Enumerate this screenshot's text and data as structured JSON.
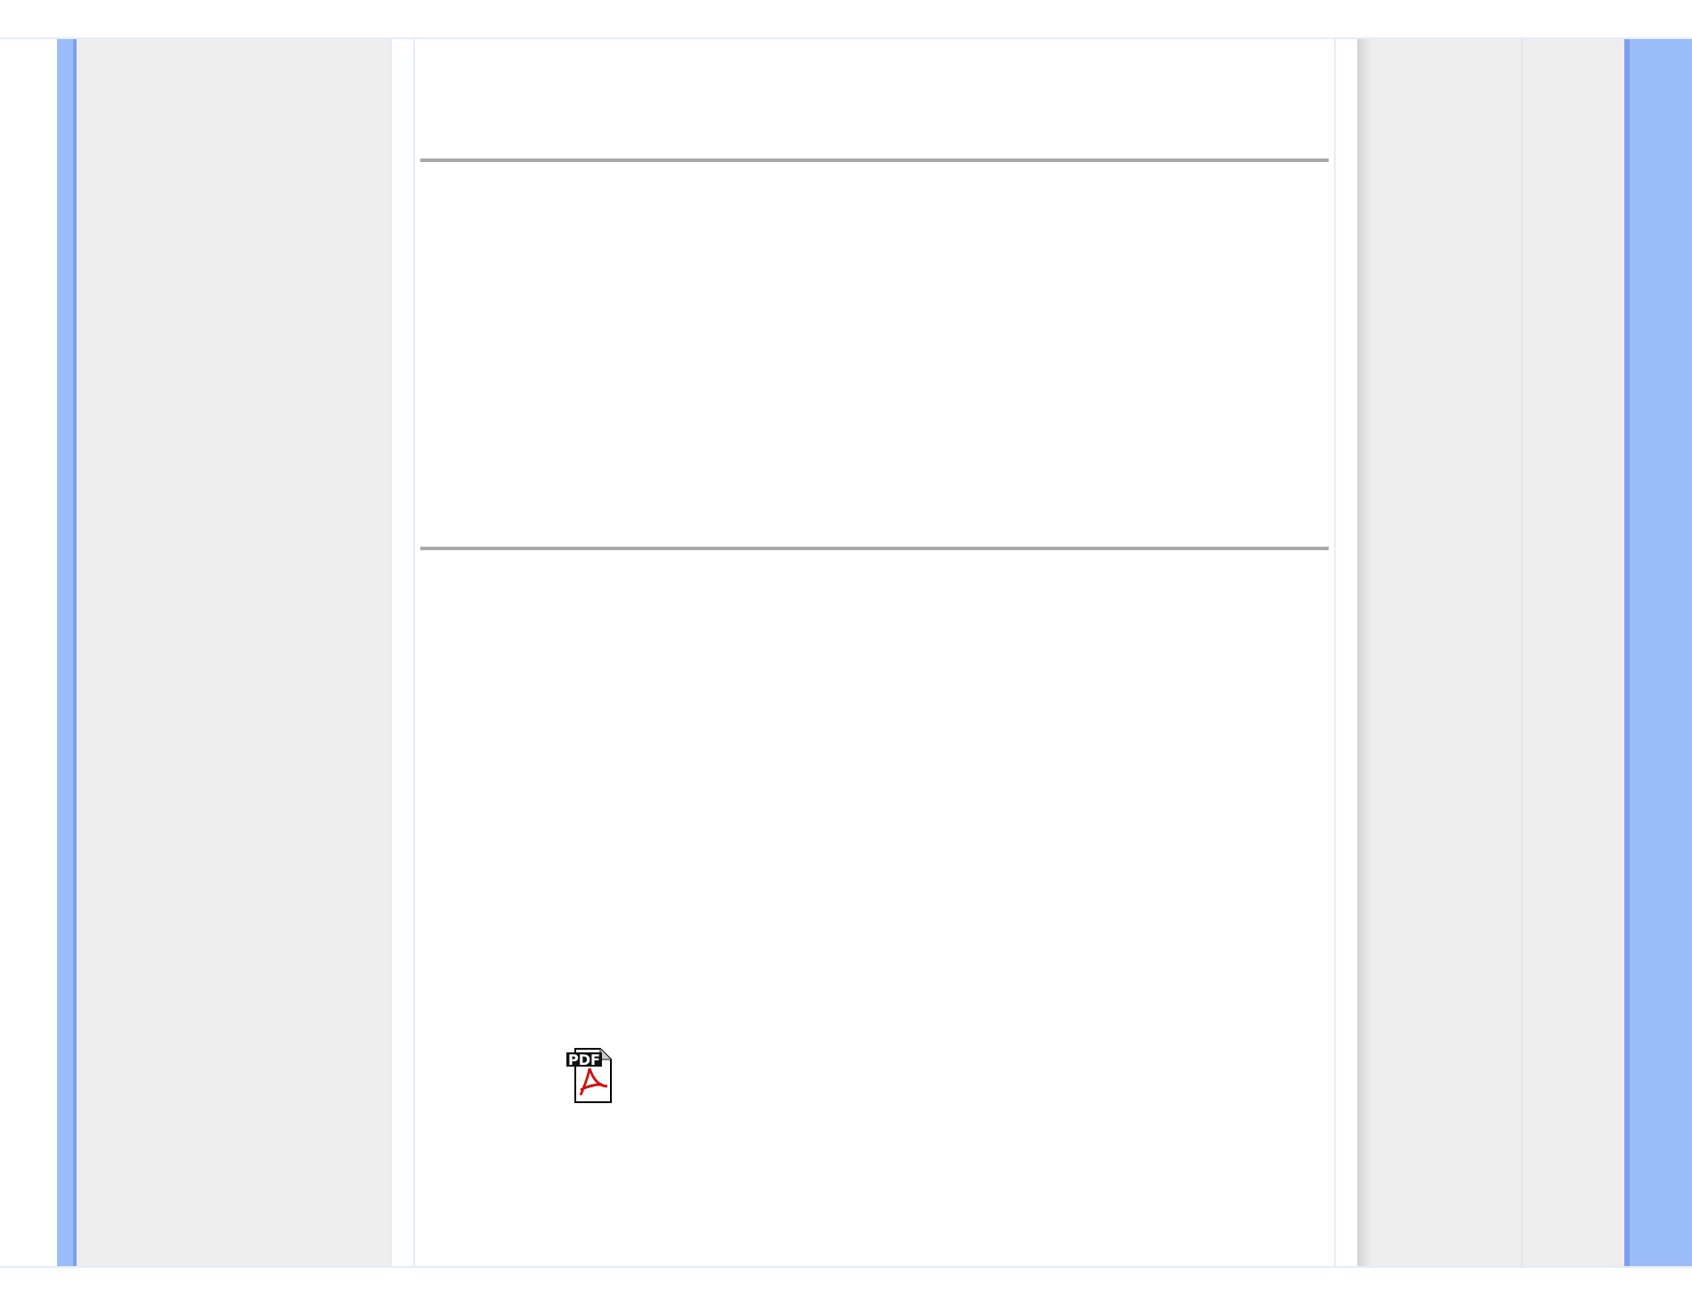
{
  "content": [
    {
      "kind": "rule"
    },
    {
      "kind": "rule"
    },
    {
      "kind": "pdf_link",
      "label": "PDF"
    }
  ]
}
